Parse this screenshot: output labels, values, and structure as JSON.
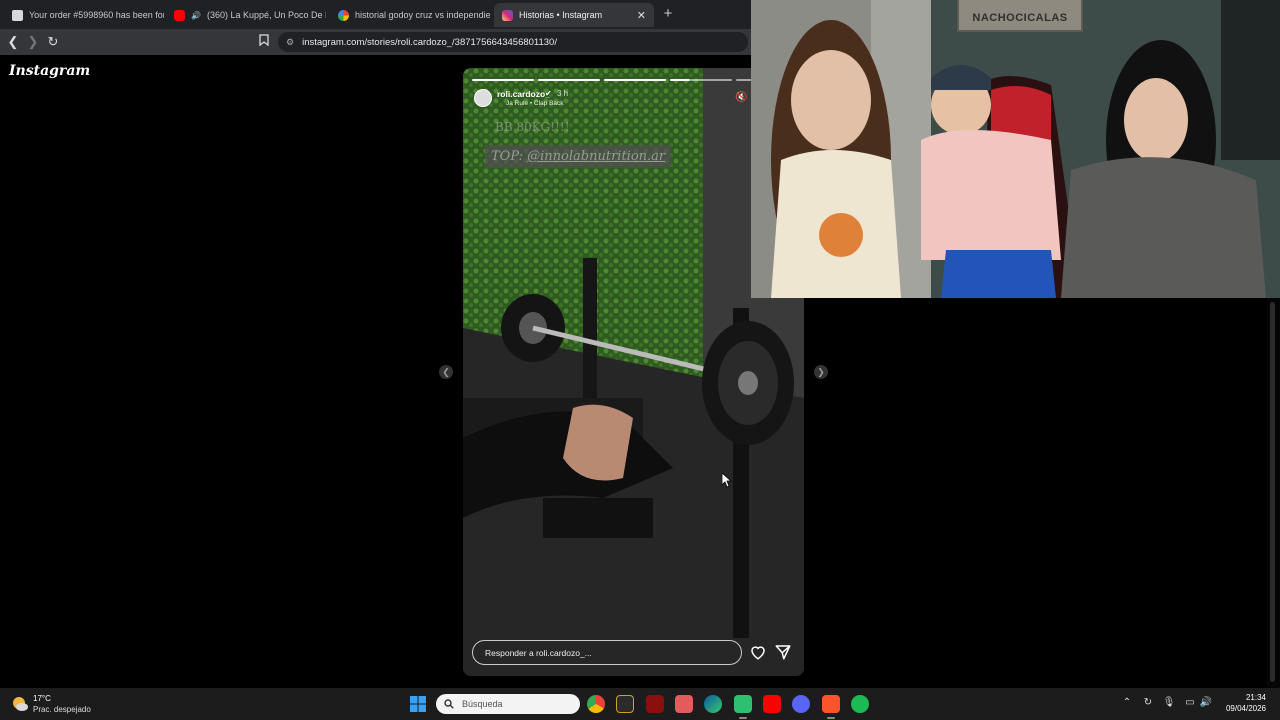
{
  "browser": {
    "tabs": [
      {
        "label": "Your order #5998960 has been forme",
        "active": false
      },
      {
        "label": "(360) La Kuppé, Un Poco De Ruid",
        "active": false
      },
      {
        "label": "historial godoy cruz vs independient",
        "active": false
      },
      {
        "label": "Historias • Instagram",
        "active": true
      }
    ],
    "url": "instagram.com/stories/roli.cardozo_/3871756643456801130/"
  },
  "instagram": {
    "logo": "Instagram",
    "story": {
      "username": "roli.cardozo_",
      "time": "3 h",
      "music": "Ja Rule • Clap Back",
      "caption_top": "BB 80KG!!!!",
      "caption_sponsor_prefix": "TOP:",
      "caption_sponsor_handle": "@innolabnutrition.ar",
      "reply_placeholder": "Responder a roli.cardozo_...",
      "progress_segments": 5,
      "progress_current": 4
    }
  },
  "webcam": {
    "sign_text": "NACHOCICALAS"
  },
  "taskbar": {
    "weather_temp": "17°C",
    "weather_desc": "Prac. despejado",
    "search_placeholder": "Búsqueda",
    "time": "21:34",
    "date": "09/04/2026"
  },
  "colors": {
    "chrome_dark": "#202124",
    "chrome_toolbar": "#35363a",
    "taskbar": "#1c1c1c",
    "accent_youtube": "#ff0000",
    "accent_spotify": "#1db954"
  }
}
